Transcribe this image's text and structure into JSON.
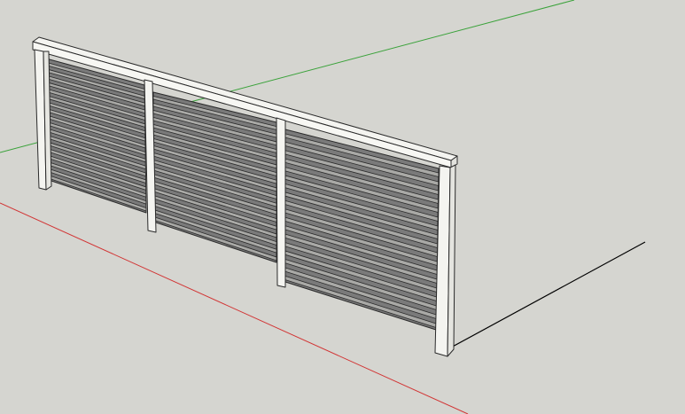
{
  "viewport": {
    "background": "#d5d5d0",
    "axis_colors": {
      "red": "#d23434",
      "green": "#3aa23a",
      "shadow": "#000000"
    },
    "material_colors": {
      "frame_face": "#f4f4f0",
      "frame_edge": "#2a2a2a",
      "slat_fill": "#8e8e8e",
      "slat_shadow": "#3a3a3a"
    }
  }
}
